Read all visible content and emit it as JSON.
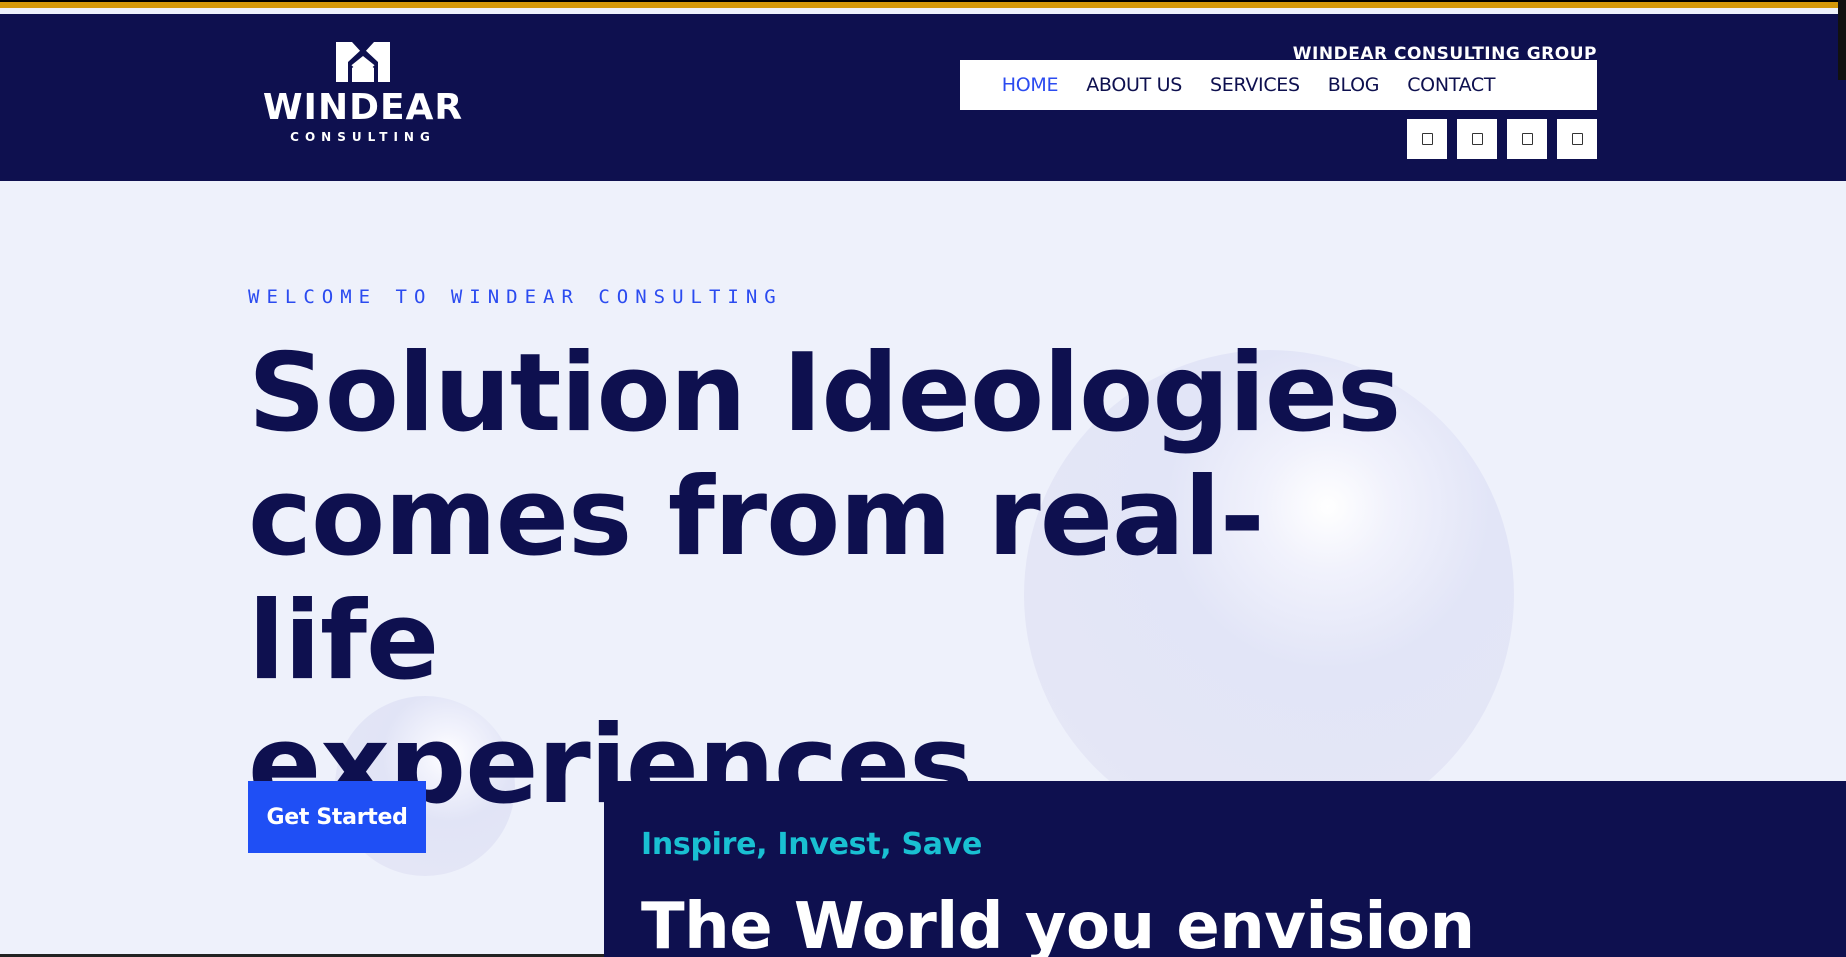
{
  "header": {
    "logo": {
      "word": "WINDEAR",
      "sub": "CONSULTING",
      "mark_icon": "windear-crown-logo-icon"
    },
    "group_name": "WINDEAR CONSULTING GROUP",
    "nav": {
      "home": "HOME",
      "about": "ABOUT US",
      "services": "SERVICES",
      "blog": "BLOG",
      "contact": "CONTACT",
      "active": "HOME"
    },
    "social_icons": [
      "social-icon-1",
      "social-icon-2",
      "social-icon-3",
      "social-icon-4"
    ]
  },
  "hero": {
    "eyebrow": "WELCOME TO WINDEAR CONSULTING",
    "title_line1": "Solution Ideologies",
    "title_line2": "comes from real-life",
    "title_line3": "experiences",
    "cta_label": "Get Started"
  },
  "panel": {
    "tagline": "Inspire, Invest, Save",
    "heading": "The World you envision"
  },
  "colors": {
    "navy": "#0e104f",
    "accent_blue": "#2b4bf0",
    "button_blue": "#1f4ff5",
    "teal": "#19c0d2",
    "gold_stripe": "#d4980a",
    "page_bg": "#eef1fb"
  }
}
